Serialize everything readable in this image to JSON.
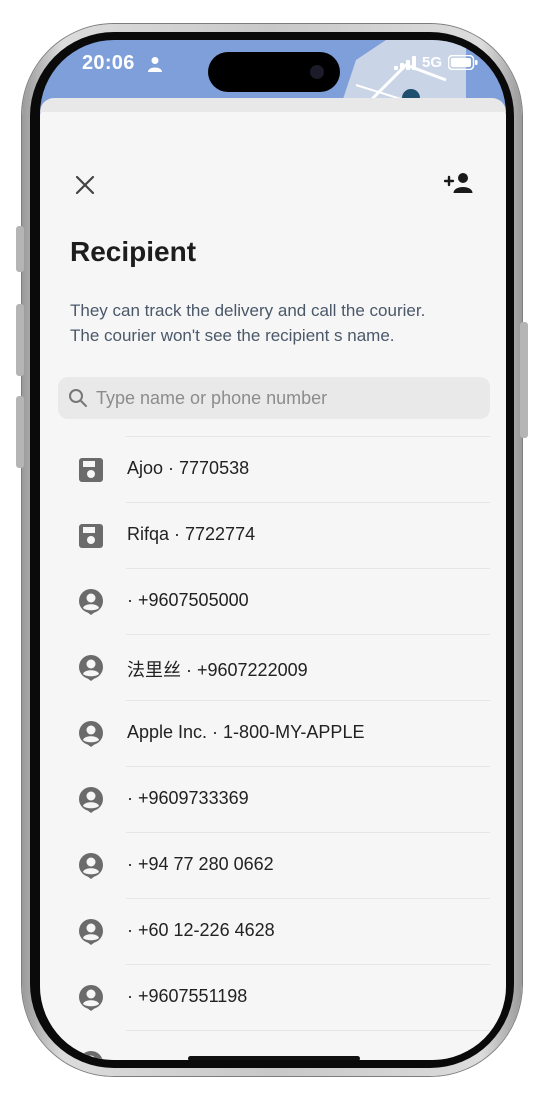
{
  "status": {
    "time": "20:06",
    "network": "5G"
  },
  "header": {
    "title": "Recipient",
    "description_line1": "They can track the delivery and call the courier.",
    "description_line2": "The courier won't see the recipient s name."
  },
  "search": {
    "placeholder": "Type name or phone number",
    "value": ""
  },
  "contacts": [
    {
      "icon": "saved-icon",
      "label": "Ajoo · 7770538"
    },
    {
      "icon": "saved-icon",
      "label": "Rifqa · 7722774"
    },
    {
      "icon": "person-icon",
      "label": "· +9607505000"
    },
    {
      "icon": "person-icon",
      "label": "法里丝 · +9607222009"
    },
    {
      "icon": "person-icon",
      "label": "Apple Inc. · 1-800-MY-APPLE"
    },
    {
      "icon": "person-icon",
      "label": "· +9609733369"
    },
    {
      "icon": "person-icon",
      "label": "· +94 77 280 0662"
    },
    {
      "icon": "person-icon",
      "label": "· +60 12-226 4628"
    },
    {
      "icon": "person-icon",
      "label": "· +9607551198"
    }
  ],
  "colors": {
    "title": "#1d1d1d",
    "description": "#4a5869",
    "icon": "#6b6b6b",
    "map_blue": "#7e9fd9"
  }
}
